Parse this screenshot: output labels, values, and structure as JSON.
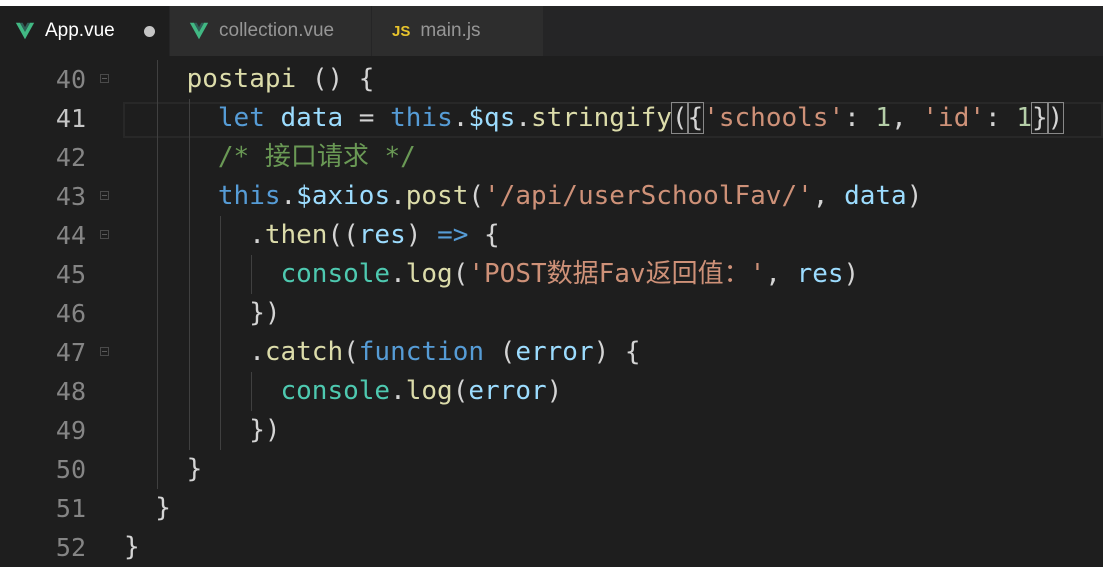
{
  "tabs": [
    {
      "label": "App.vue",
      "icon": "vue-icon",
      "active": true,
      "modified": true
    },
    {
      "label": "collection.vue",
      "icon": "vue-icon",
      "active": false,
      "modified": false
    },
    {
      "label": "main.js",
      "icon": "js-icon",
      "icon_text": "JS",
      "active": false,
      "modified": false
    }
  ],
  "editor": {
    "current_line": 41,
    "lines": [
      {
        "num": "40",
        "fold": true,
        "indent": 2,
        "tokens": [
          [
            "fn",
            "postapi"
          ],
          [
            "punc",
            " () {"
          ]
        ]
      },
      {
        "num": "41",
        "fold": false,
        "indent": 3,
        "tokens": [
          [
            "kw",
            "let"
          ],
          [
            "punc",
            " "
          ],
          [
            "var",
            "data"
          ],
          [
            "punc",
            " = "
          ],
          [
            "kw",
            "this"
          ],
          [
            "punc",
            "."
          ],
          [
            "var",
            "$qs"
          ],
          [
            "punc",
            "."
          ],
          [
            "fn",
            "stringify"
          ],
          [
            "bm",
            "("
          ],
          [
            "bm",
            "{"
          ],
          [
            "str",
            "'schools'"
          ],
          [
            "punc",
            ": "
          ],
          [
            "num",
            "1"
          ],
          [
            "punc",
            ", "
          ],
          [
            "str",
            "'id'"
          ],
          [
            "punc",
            ": "
          ],
          [
            "num",
            "1"
          ],
          [
            "bm",
            "}"
          ],
          [
            "bm",
            ")"
          ]
        ]
      },
      {
        "num": "42",
        "fold": false,
        "indent": 3,
        "tokens": [
          [
            "cmt",
            "/* 接口请求 */"
          ]
        ]
      },
      {
        "num": "43",
        "fold": true,
        "indent": 3,
        "tokens": [
          [
            "kw",
            "this"
          ],
          [
            "punc",
            "."
          ],
          [
            "var",
            "$axios"
          ],
          [
            "punc",
            "."
          ],
          [
            "fn",
            "post"
          ],
          [
            "punc",
            "("
          ],
          [
            "str",
            "'/api/userSchoolFav/'"
          ],
          [
            "punc",
            ", "
          ],
          [
            "var",
            "data"
          ],
          [
            "punc",
            ")"
          ]
        ]
      },
      {
        "num": "44",
        "fold": true,
        "indent": 4,
        "tokens": [
          [
            "punc",
            "."
          ],
          [
            "fn",
            "then"
          ],
          [
            "punc",
            "(("
          ],
          [
            "var",
            "res"
          ],
          [
            "punc",
            ") "
          ],
          [
            "kw",
            "=>"
          ],
          [
            "punc",
            " {"
          ]
        ]
      },
      {
        "num": "45",
        "fold": false,
        "indent": 5,
        "tokens": [
          [
            "type",
            "console"
          ],
          [
            "punc",
            "."
          ],
          [
            "fn",
            "log"
          ],
          [
            "punc",
            "("
          ],
          [
            "str",
            "'POST数据Fav返回值：'"
          ],
          [
            "punc",
            ", "
          ],
          [
            "var",
            "res"
          ],
          [
            "punc",
            ")"
          ]
        ]
      },
      {
        "num": "46",
        "fold": false,
        "indent": 4,
        "tokens": [
          [
            "punc",
            "})"
          ]
        ]
      },
      {
        "num": "47",
        "fold": true,
        "indent": 4,
        "tokens": [
          [
            "punc",
            "."
          ],
          [
            "fn",
            "catch"
          ],
          [
            "punc",
            "("
          ],
          [
            "kw",
            "function"
          ],
          [
            "punc",
            " ("
          ],
          [
            "var",
            "error"
          ],
          [
            "punc",
            ") {"
          ]
        ]
      },
      {
        "num": "48",
        "fold": false,
        "indent": 5,
        "tokens": [
          [
            "type",
            "console"
          ],
          [
            "punc",
            "."
          ],
          [
            "fn",
            "log"
          ],
          [
            "punc",
            "("
          ],
          [
            "var",
            "error"
          ],
          [
            "punc",
            ")"
          ]
        ]
      },
      {
        "num": "49",
        "fold": false,
        "indent": 4,
        "tokens": [
          [
            "punc",
            "})"
          ]
        ]
      },
      {
        "num": "50",
        "fold": false,
        "indent": 2,
        "tokens": [
          [
            "punc",
            "}"
          ]
        ]
      },
      {
        "num": "51",
        "fold": false,
        "indent": 1,
        "tokens": [
          [
            "punc",
            "}"
          ]
        ]
      },
      {
        "num": "52",
        "fold": false,
        "indent": 0,
        "tokens": [
          [
            "punc",
            "}"
          ]
        ]
      }
    ]
  },
  "colors": {
    "background": "#1e1e1e",
    "function": "#dcdcaa",
    "keyword": "#569cd6",
    "variable": "#9cdcfe",
    "string": "#ce9178",
    "number": "#b5cea8",
    "comment": "#6a9955",
    "type": "#4ec9b0",
    "vue_icon": "#41b883",
    "js_icon": "#e8c42c"
  }
}
